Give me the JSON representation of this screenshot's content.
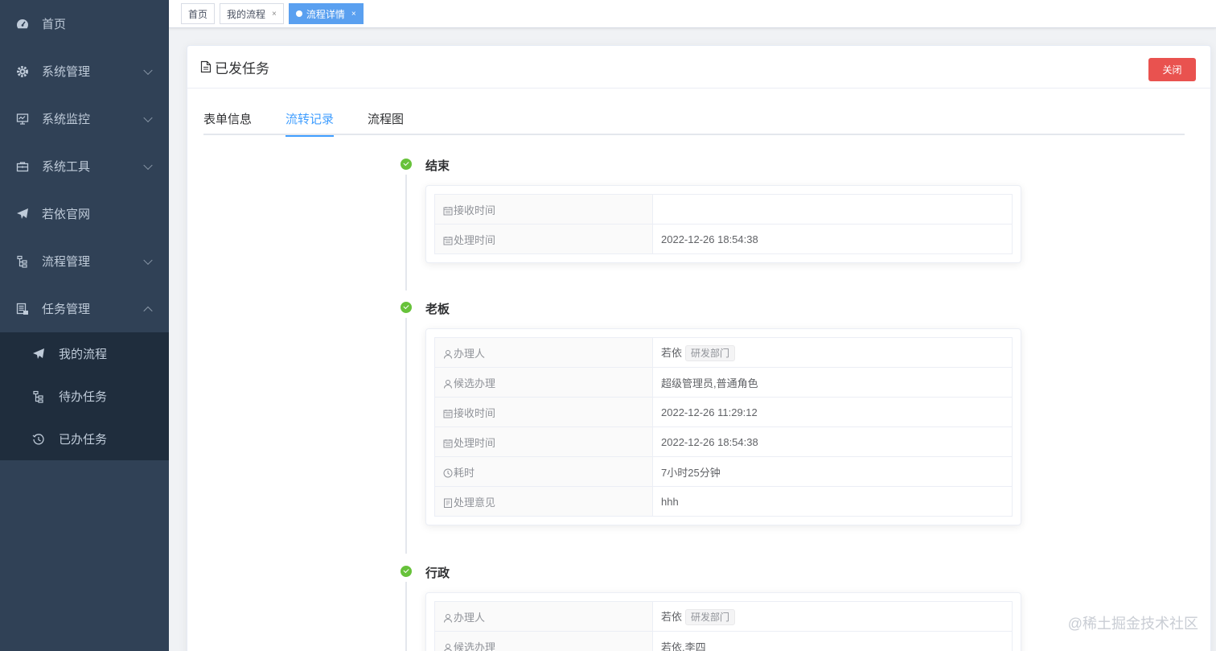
{
  "sidebar": {
    "items": [
      {
        "label": "首页",
        "icon": "dashboard-icon"
      },
      {
        "label": "系统管理",
        "icon": "gear-icon"
      },
      {
        "label": "系统监控",
        "icon": "monitor-icon"
      },
      {
        "label": "系统工具",
        "icon": "toolbox-icon"
      },
      {
        "label": "若依官网",
        "icon": "paper-plane-icon"
      },
      {
        "label": "流程管理",
        "icon": "tree-icon"
      },
      {
        "label": "任务管理",
        "icon": "server-icon"
      }
    ],
    "sub_items": [
      {
        "label": "我的流程",
        "icon": "paper-plane-icon"
      },
      {
        "label": "待办任务",
        "icon": "tree-icon"
      },
      {
        "label": "已办任务",
        "icon": "history-icon"
      }
    ]
  },
  "tags": [
    {
      "label": "首页"
    },
    {
      "label": "我的流程",
      "close": "×"
    },
    {
      "label": "流程详情",
      "close": "×",
      "active": true
    }
  ],
  "card": {
    "title": "已发任务",
    "close_label": "关闭"
  },
  "tabs": [
    {
      "label": "表单信息"
    },
    {
      "label": "流转记录",
      "active": true
    },
    {
      "label": "流程图"
    }
  ],
  "timeline": [
    {
      "title": "结束",
      "rows": [
        {
          "label": "接收时间",
          "icon": "calendar-icon",
          "value": ""
        },
        {
          "label": "处理时间",
          "icon": "calendar-icon",
          "value": "2022-12-26 18:54:38"
        }
      ]
    },
    {
      "title": "老板",
      "rows": [
        {
          "label": "办理人",
          "icon": "user-icon",
          "value": "若依",
          "tag": "研发部门"
        },
        {
          "label": "候选办理",
          "icon": "user-icon",
          "value": "超级管理员,普通角色"
        },
        {
          "label": "接收时间",
          "icon": "calendar-icon",
          "value": "2022-12-26 11:29:12"
        },
        {
          "label": "处理时间",
          "icon": "calendar-icon",
          "value": "2022-12-26 18:54:38"
        },
        {
          "label": "耗时",
          "icon": "clock-icon",
          "value": "7小时25分钟"
        },
        {
          "label": "处理意见",
          "icon": "document-icon",
          "value": "hhh"
        }
      ]
    },
    {
      "title": "行政",
      "rows": [
        {
          "label": "办理人",
          "icon": "user-icon",
          "value": "若依",
          "tag": "研发部门"
        },
        {
          "label": "候选办理",
          "icon": "user-icon",
          "value": "若依,李四"
        }
      ]
    }
  ],
  "watermark": "@稀土掘金技术社区",
  "colors": {
    "sidebar_bg": "#304156",
    "submenu_bg": "#1f2d3d",
    "accent": "#409eff",
    "active_tag": "#5aa0f0",
    "danger": "#e9524f",
    "success": "#67c23a"
  }
}
